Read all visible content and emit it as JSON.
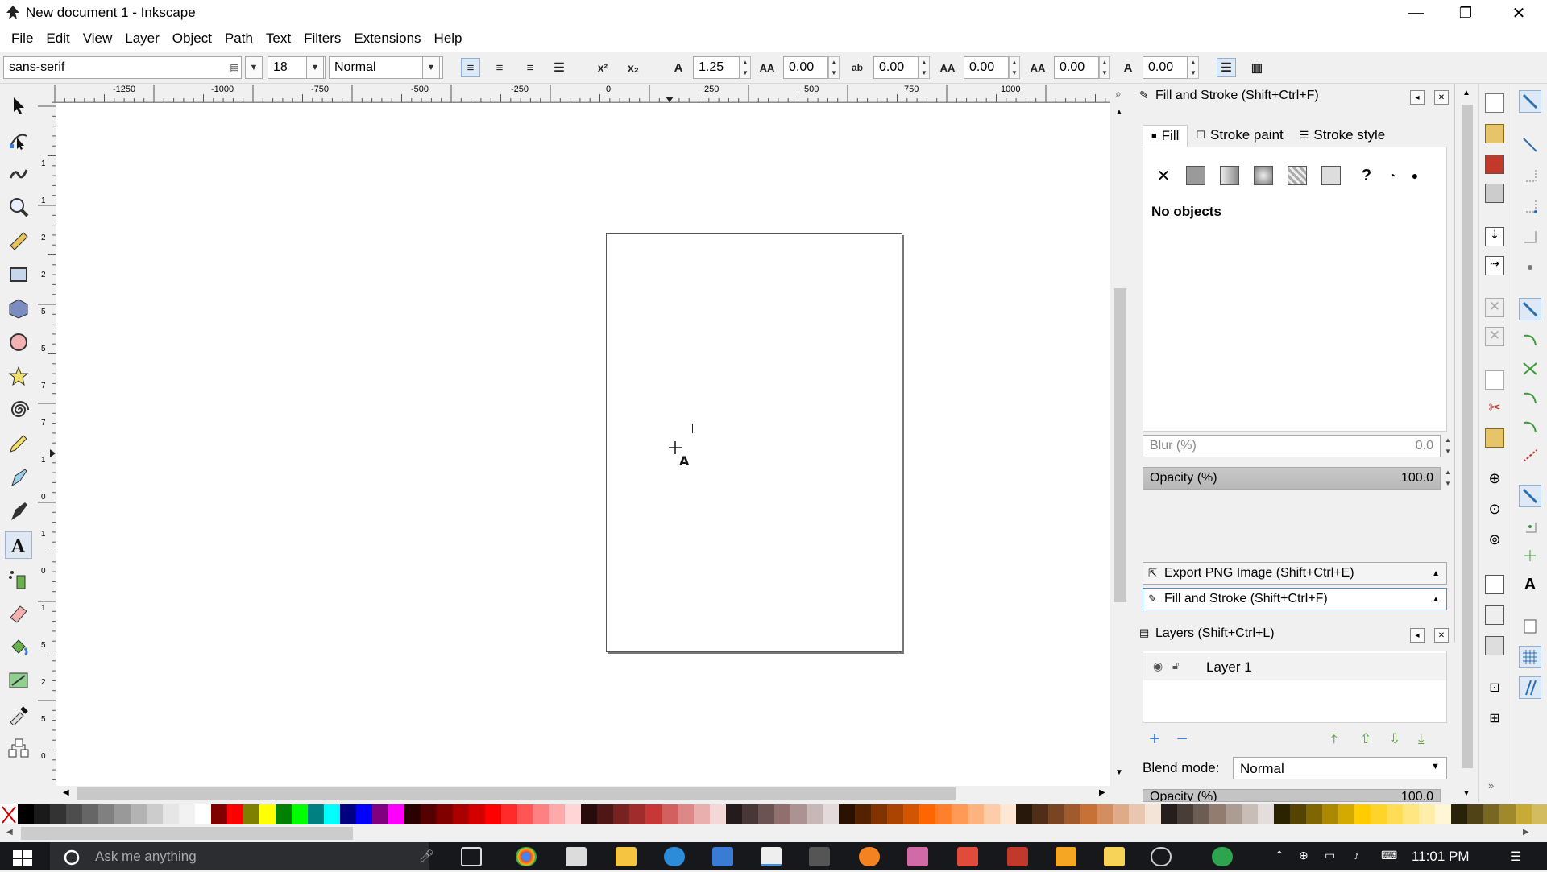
{
  "window": {
    "title": "New document 1 - Inkscape",
    "minimize": "—",
    "maximize": "❐",
    "close": "✕"
  },
  "menu": [
    "File",
    "Edit",
    "View",
    "Layer",
    "Object",
    "Path",
    "Text",
    "Filters",
    "Extensions",
    "Help"
  ],
  "text_toolbar": {
    "font_family": "sans-serif",
    "font_size": "18",
    "font_style": "Normal",
    "line_spacing": "1.25",
    "letter_spacing": "0.00",
    "word_spacing": "0.00",
    "kerning": "0.00",
    "vertical_shift": "0.00",
    "rotation": "0.00",
    "superscript_icon": "x²",
    "subscript_icon": "x₂"
  },
  "ruler": {
    "labels": [
      "-1250",
      "-1000",
      "-750",
      "-500",
      "-250",
      "0",
      "250",
      "500",
      "750",
      "1000"
    ]
  },
  "vruler": {
    "labels": [
      "1",
      "1",
      "2",
      "2",
      "5",
      "5",
      "7",
      "7",
      "1",
      "0",
      "1",
      "0",
      "1",
      "5",
      "2",
      "5",
      "0"
    ]
  },
  "tools": [
    "selector-tool",
    "node-tool",
    "tweak-tool",
    "zoom-tool",
    "measure-tool",
    "rectangle-tool",
    "3dbox-tool",
    "ellipse-tool",
    "star-tool",
    "spiral-tool",
    "pencil-tool",
    "pen-tool",
    "calligraphy-tool",
    "text-tool",
    "spray-tool",
    "eraser-tool",
    "bucket-tool",
    "gradient-tool",
    "dropper-tool",
    "connector-tool"
  ],
  "fill_stroke": {
    "title": "Fill and Stroke (Shift+Ctrl+F)",
    "tabs": [
      "Fill",
      "Stroke paint",
      "Stroke style"
    ],
    "status": "No objects",
    "paint_types": [
      "✕",
      "?"
    ],
    "blur_label": "Blur (%)",
    "blur_value": "0.0",
    "opacity_label": "Opacity (%)",
    "opacity_value": "100.0"
  },
  "docked": {
    "export_png": "Export PNG Image (Shift+Ctrl+E)",
    "fill_stroke": "Fill and Stroke (Shift+Ctrl+F)"
  },
  "layers": {
    "title": "Layers (Shift+Ctrl+L)",
    "items": [
      {
        "name": "Layer 1"
      }
    ],
    "blend_label": "Blend mode:",
    "blend_value": "Normal",
    "opacity_label": "Opacity (%)",
    "opacity_value": "100.0"
  },
  "palette_colors": [
    "#000000",
    "#1a1a1a",
    "#333333",
    "#4d4d4d",
    "#666666",
    "#808080",
    "#999999",
    "#b3b3b3",
    "#cccccc",
    "#e6e6e6",
    "#f2f2f2",
    "#ffffff",
    "#800000",
    "#ff0000",
    "#808000",
    "#ffff00",
    "#008000",
    "#00ff00",
    "#008080",
    "#00ffff",
    "#000080",
    "#0000ff",
    "#800080",
    "#ff00ff",
    "#2b0000",
    "#550000",
    "#800000",
    "#aa0000",
    "#d40000",
    "#ff0000",
    "#ff2a2a",
    "#ff5555",
    "#ff8080",
    "#ffaaaa",
    "#ffd5d5",
    "#280b0b",
    "#501616",
    "#782121",
    "#a02c2c",
    "#c83737",
    "#d35f5f",
    "#de8787",
    "#e9afaf",
    "#f4d7d7",
    "#241c1c",
    "#483737",
    "#6c5353",
    "#916f6f",
    "#ac9393",
    "#c8b7b7",
    "#e3dbdb",
    "#2b1100",
    "#552200",
    "#803300",
    "#aa4400",
    "#d45500",
    "#ff6600",
    "#ff7f2a",
    "#ff9955",
    "#ffb380",
    "#ffccaa",
    "#ffe6d5",
    "#28170b",
    "#502d16",
    "#784421",
    "#a05a2c",
    "#c87137",
    "#d38d5f",
    "#deaa87",
    "#e9c6af",
    "#f4e3d7",
    "#241f1c",
    "#483e37",
    "#6c5d53",
    "#917c6f",
    "#ac9d93",
    "#c8beb7",
    "#e3dedb",
    "#2b2200",
    "#554400",
    "#806600",
    "#aa8800",
    "#d4aa00",
    "#ffcc00",
    "#ffd42a",
    "#ffdd55",
    "#ffe680",
    "#ffeeaa",
    "#fff6d5",
    "#28220b",
    "#504416",
    "#786721",
    "#a0892c",
    "#c8ab37",
    "#d3bc5f"
  ],
  "taskbar": {
    "search_placeholder": "Ask me anything",
    "time": "11:01 PM"
  }
}
